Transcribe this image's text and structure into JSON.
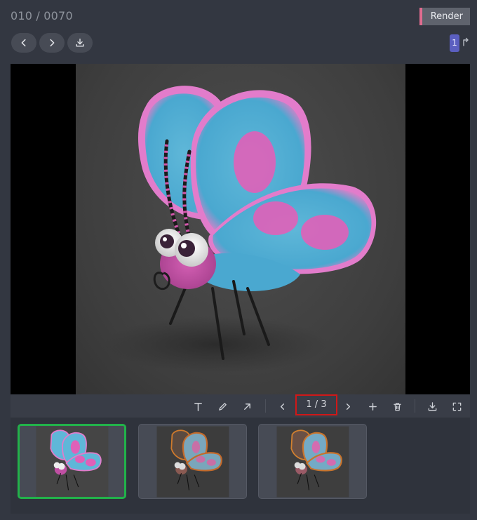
{
  "header": {
    "title": "010 / 0070",
    "status_tag": "Render",
    "status_color": "#e06c8f"
  },
  "nav": {
    "prev_icon": "chevron-left-icon",
    "next_icon": "chevron-right-icon",
    "download_icon": "download-icon"
  },
  "version": {
    "number": "1",
    "badge_color": "#5b5fc0",
    "arrow_icon": "corner-up-icon"
  },
  "viewer": {
    "image_subject": "cartoon butterfly render"
  },
  "toolbar": {
    "tools": [
      "text-icon",
      "pencil-icon",
      "arrow-icon"
    ],
    "page_indicator": "1 / 3",
    "page_current": 1,
    "page_total": 3,
    "actions": [
      "chevron-left-icon",
      "chevron-right-icon",
      "plus-icon",
      "trash-icon",
      "download-icon",
      "fullscreen-icon"
    ],
    "highlight_color": "#d01818"
  },
  "thumbnails": [
    {
      "variant": "blue-pink",
      "active": true
    },
    {
      "variant": "sketch",
      "active": false
    },
    {
      "variant": "sketch-color",
      "active": false
    }
  ],
  "colors": {
    "active_thumb_border": "#22b24a",
    "background": "#333741"
  }
}
